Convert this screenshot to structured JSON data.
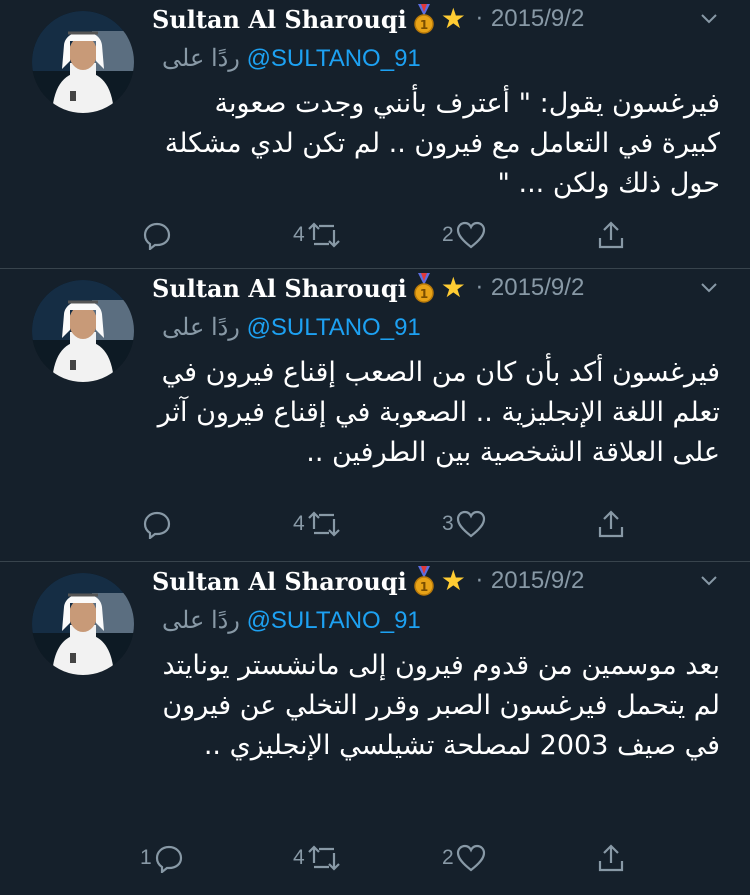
{
  "colors": {
    "background": "#15202b",
    "divider": "#38444d",
    "muted": "#8899a6",
    "link": "#1da1f2",
    "star": "#ffcc33"
  },
  "tweets": [
    {
      "name": "Sultan Al Sharouqi",
      "date": "2015/9/2",
      "reply_prefix": "ردًا على",
      "handle": "@SULTANO_91",
      "text": "فيرغسون يقول: \" أعترف بأنني وجدت صعوبة كبيرة في التعامل مع فيرون .. لم تكن لدي مشكلة حول ذلك ولكن ... \"",
      "replies": "",
      "retweets": "4",
      "likes": "2"
    },
    {
      "name": "Sultan Al Sharouqi",
      "date": "2015/9/2",
      "reply_prefix": "ردًا على",
      "handle": "@SULTANO_91",
      "text": "فيرغسون أكد بأن كان من الصعب إقناع فيرون في تعلم اللغة الإنجليزية .. الصعوبة في إقناع فيرون آثر على العلاقة الشخصية بين الطرفين ..",
      "replies": "",
      "retweets": "4",
      "likes": "3"
    },
    {
      "name": "Sultan Al Sharouqi",
      "date": "2015/9/2",
      "reply_prefix": "ردًا على",
      "handle": "@SULTANO_91",
      "text": "بعد موسمين من قدوم فيرون إلى مانشستر يونايتد لم يتحمل فيرغسون الصبر وقرر التخلي عن فيرون في صيف 2003 لمصلحة تشيلسي الإنجليزي ..",
      "replies": "1",
      "retweets": "4",
      "likes": "2"
    }
  ]
}
